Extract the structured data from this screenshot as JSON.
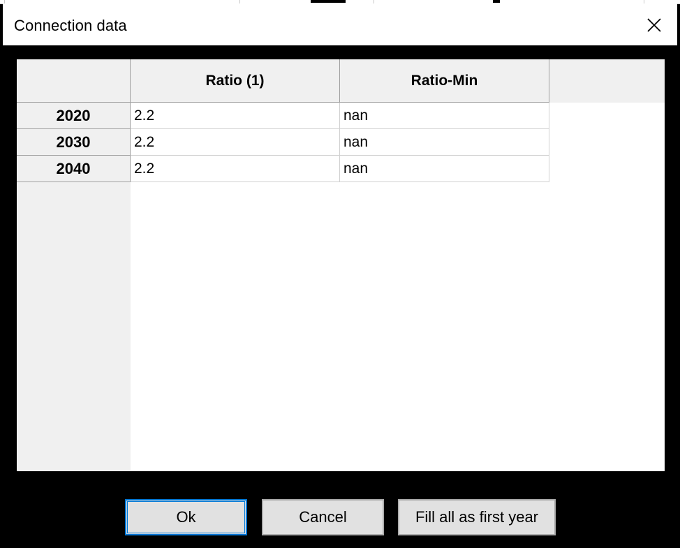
{
  "dialog": {
    "title": "Connection data",
    "close_icon": "close-x-icon"
  },
  "table": {
    "columns": [
      "Ratio (1)",
      "Ratio-Min"
    ],
    "rows": [
      {
        "header": "2020",
        "values": [
          "2.2",
          "nan"
        ]
      },
      {
        "header": "2030",
        "values": [
          "2.2",
          "nan"
        ]
      },
      {
        "header": "2040",
        "values": [
          "2.2",
          "nan"
        ]
      }
    ]
  },
  "buttons": {
    "ok": "Ok",
    "cancel": "Cancel",
    "fill": "Fill all as first year"
  },
  "colors": {
    "header_bg": "#f0f0f0",
    "accent": "#0078d7",
    "button_bg": "#e1e1e1"
  }
}
